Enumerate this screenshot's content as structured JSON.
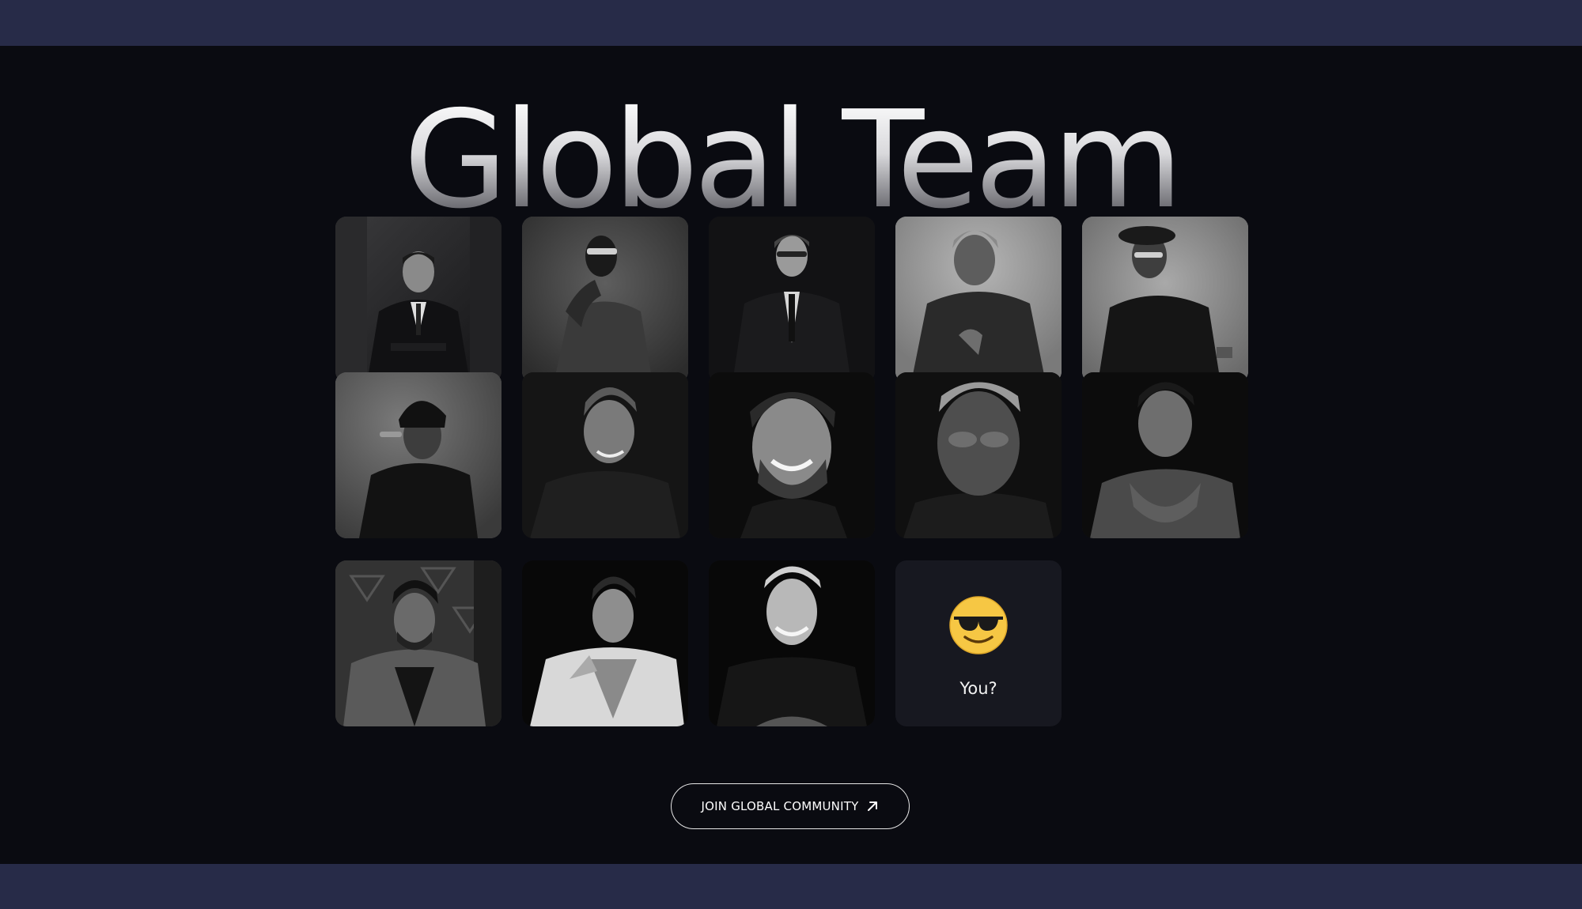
{
  "page": {
    "title": "Global Team",
    "placeholder_card": {
      "emoji": "sunglasses-smiling-face-icon",
      "label": "You?"
    },
    "cta": {
      "label": "JOIN GLOBAL COMMUNITY",
      "icon": "arrow-up-right-icon"
    }
  },
  "team_photos": [
    {
      "row": 1,
      "col": 1,
      "description_icon": "person-photo"
    },
    {
      "row": 1,
      "col": 2,
      "description_icon": "person-photo"
    },
    {
      "row": 1,
      "col": 3,
      "description_icon": "person-photo"
    },
    {
      "row": 1,
      "col": 4,
      "description_icon": "person-photo"
    },
    {
      "row": 1,
      "col": 5,
      "description_icon": "person-photo"
    },
    {
      "row": 2,
      "col": 1,
      "description_icon": "person-photo"
    },
    {
      "row": 2,
      "col": 2,
      "description_icon": "person-photo"
    },
    {
      "row": 2,
      "col": 3,
      "description_icon": "person-photo"
    },
    {
      "row": 2,
      "col": 4,
      "description_icon": "person-photo"
    },
    {
      "row": 2,
      "col": 5,
      "description_icon": "person-photo"
    },
    {
      "row": 3,
      "col": 1,
      "description_icon": "person-photo"
    },
    {
      "row": 3,
      "col": 2,
      "description_icon": "person-photo"
    },
    {
      "row": 3,
      "col": 3,
      "description_icon": "person-photo"
    }
  ],
  "colors": {
    "band": "#272b48",
    "background": "#0a0b11",
    "placeholder_card": "#171820",
    "emoji_yellow": "#f6c744"
  }
}
